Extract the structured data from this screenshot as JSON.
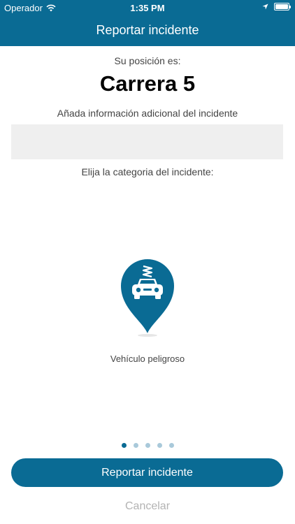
{
  "status_bar": {
    "carrier": "Operador",
    "time": "1:35 PM",
    "icons": [
      "wifi-icon",
      "location-arrow-icon",
      "battery-icon"
    ]
  },
  "header": {
    "title": "Reportar incidente",
    "background_color": "#0a6b94"
  },
  "position": {
    "label": "Su posición es:",
    "street": "Carrera 5"
  },
  "info": {
    "label": "Añada información adicional del incidente",
    "value": "",
    "placeholder": ""
  },
  "category": {
    "label": "Elija la categoria del incidente:",
    "selected": {
      "name": "Vehículo peligroso",
      "icon": "dangerous-vehicle-pin-icon"
    },
    "pages": 5,
    "current_page": 1
  },
  "actions": {
    "report_label": "Reportar incidente",
    "cancel_label": "Cancelar"
  },
  "colors": {
    "accent": "#0a6b94",
    "inactive_dot": "#a9c9da",
    "cancel_text": "#b3b3b3",
    "input_background": "#efefef"
  }
}
